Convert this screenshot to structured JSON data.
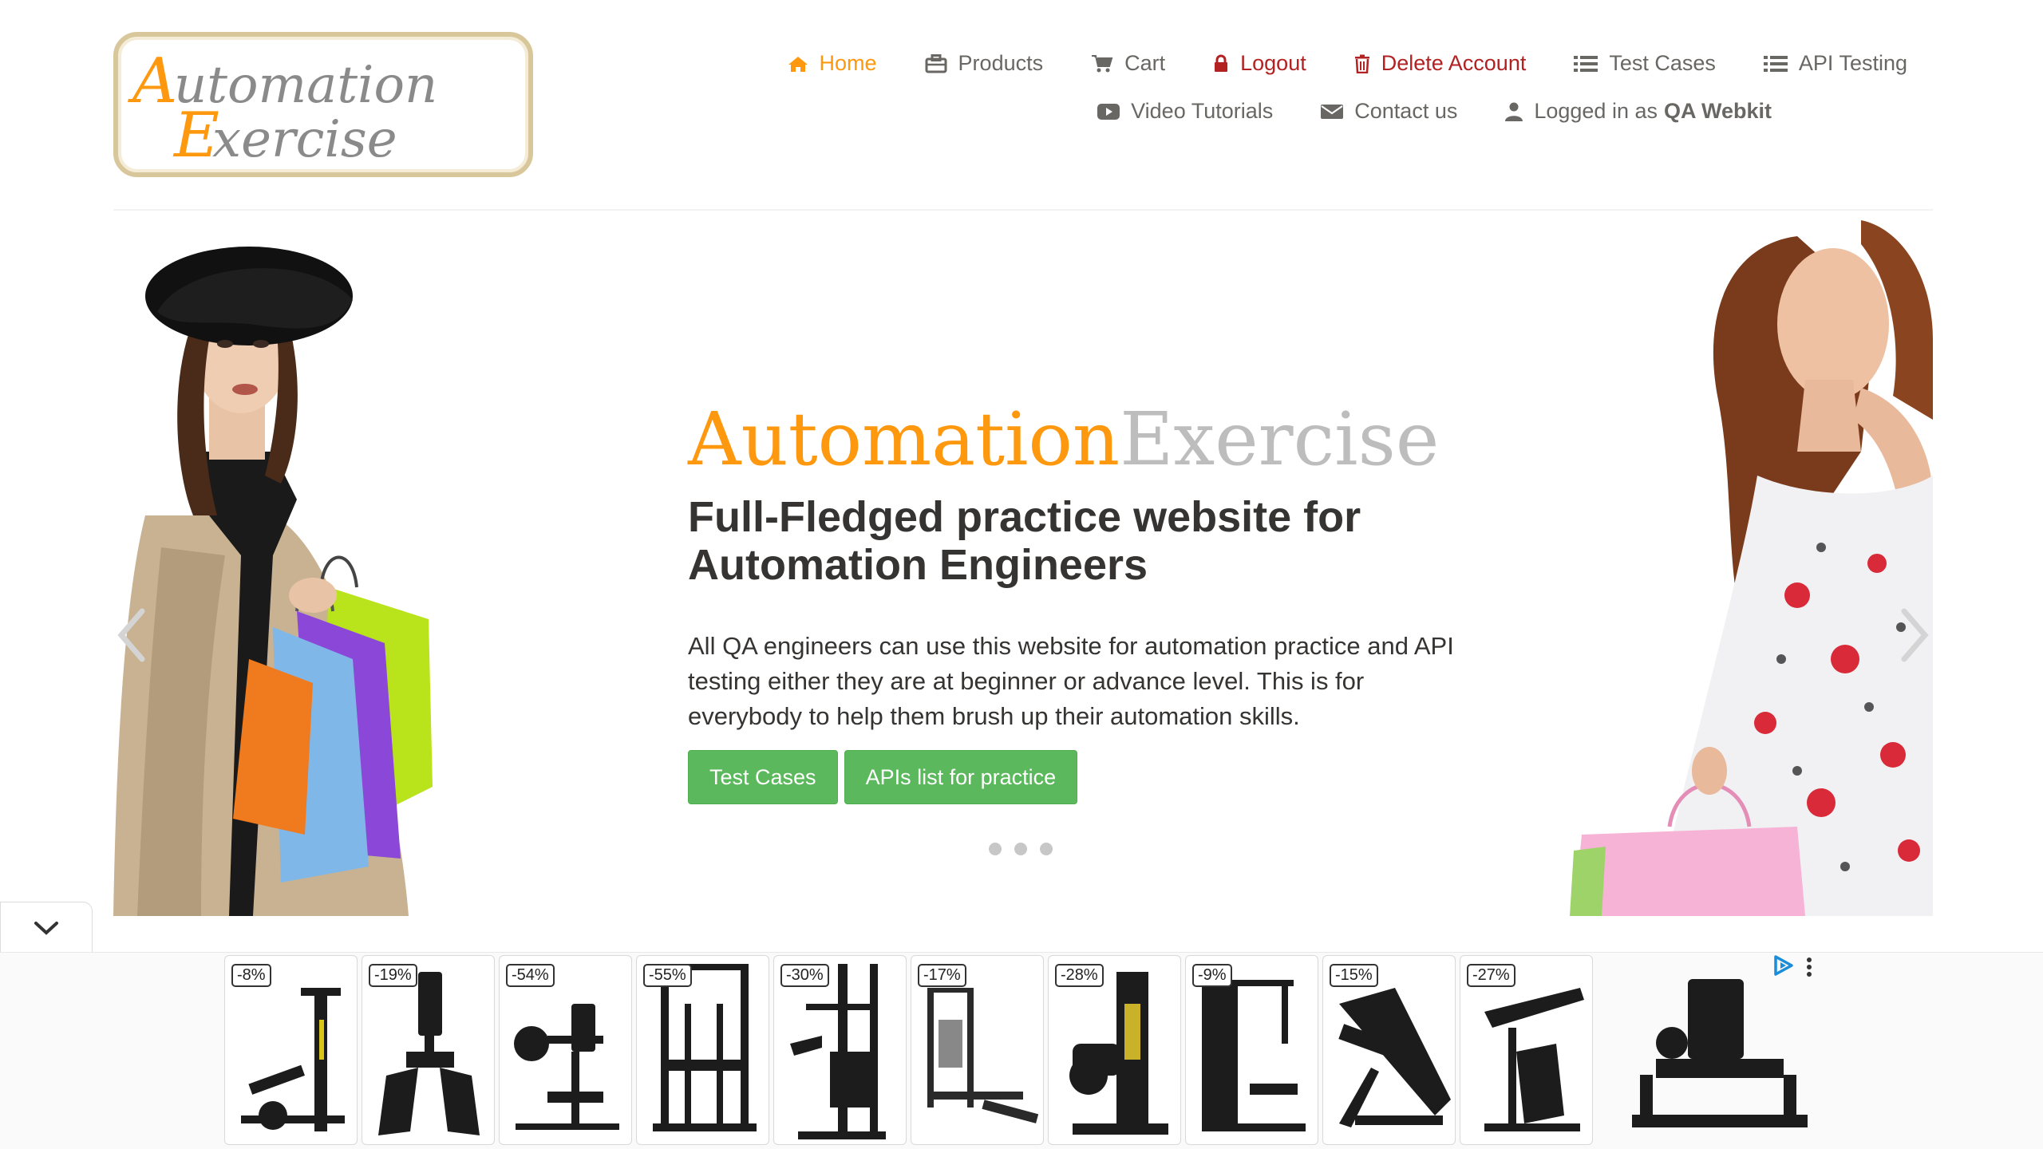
{
  "header": {
    "logo_text_line1": "Automation",
    "logo_text_line2": "Exercise",
    "nav_row1": [
      {
        "label": "Home",
        "icon": "home-icon"
      },
      {
        "label": "Products",
        "icon": "briefcase-icon"
      },
      {
        "label": "Cart",
        "icon": "cart-icon"
      },
      {
        "label": "Logout",
        "icon": "lock-icon"
      },
      {
        "label": "Delete Account",
        "icon": "trash-icon"
      },
      {
        "label": "Test Cases",
        "icon": "list-icon"
      },
      {
        "label": "API Testing",
        "icon": "list-icon"
      }
    ],
    "nav_row2": [
      {
        "label": "Video Tutorials",
        "icon": "youtube-play-icon"
      },
      {
        "label": "Contact us",
        "icon": "envelope-icon"
      },
      {
        "label": "Logged in as",
        "icon": "user-icon",
        "username": "QA Webkit"
      }
    ]
  },
  "hero": {
    "brand_part1": "Automation",
    "brand_part2": "Exercise",
    "headline": "Full-Fledged practice website for Automation Engineers",
    "description": "All QA engineers can use this website for automation practice and API testing either they are at beginner or advance level. This is for everybody to help them brush up their automation skills.",
    "button_test_cases": "Test Cases",
    "button_apis": "APIs list for practice",
    "slide_count": 3,
    "active_slide": 1
  },
  "colors": {
    "accent": "#FE980F",
    "button_green": "#5cb85c",
    "danger": "#b22222",
    "text": "#696763",
    "headline": "#363432"
  },
  "ads": {
    "discounts": [
      "-8%",
      "-19%",
      "-54%",
      "-55%",
      "-30%",
      "-17%",
      "-28%",
      "-9%",
      "-15%",
      "-27%"
    ]
  }
}
